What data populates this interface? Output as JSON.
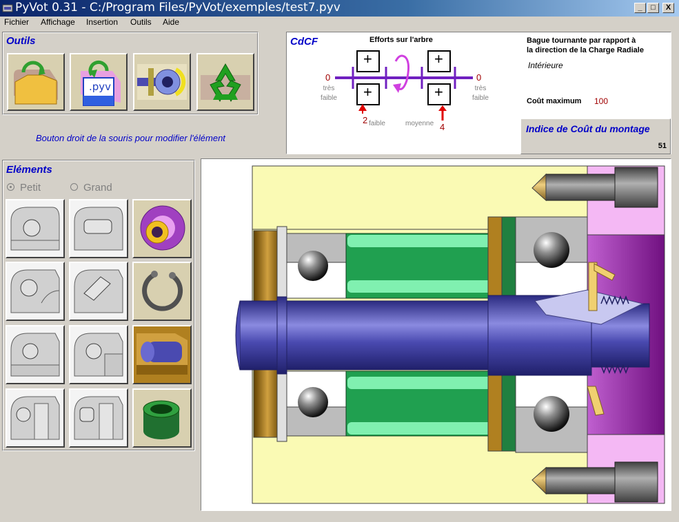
{
  "window": {
    "title": "PyVot 0.31 - C:/Program Files/PyVot/exemples/test7.pyv",
    "min_label": "_",
    "max_label": "□",
    "close_label": "X"
  },
  "menu": [
    "Fichier",
    "Affichage",
    "Insertion",
    "Outils",
    "Aide"
  ],
  "outils": {
    "title": "Outils",
    "buttons": [
      {
        "name": "open-file",
        "icon": "folder-open-icon"
      },
      {
        "name": "save-pyv",
        "icon": "save-pyv-icon",
        "label": ".pyv"
      },
      {
        "name": "assembly-view",
        "icon": "assembly-icon"
      },
      {
        "name": "recycle",
        "icon": "recycle-icon"
      }
    ]
  },
  "hint": "Bouton droit de la souris pour modifier l'élément",
  "elements": {
    "title": "Eléments",
    "size_small": "Petit",
    "size_large": "Grand",
    "selected_size": "Petit",
    "items": [
      {
        "name": "ball-bearing",
        "icon": "ball-bearing-icon"
      },
      {
        "name": "roller-bearing",
        "icon": "roller-bearing-icon"
      },
      {
        "name": "lock-nut-washer",
        "icon": "lock-nut-icon"
      },
      {
        "name": "ball-bearing-small",
        "icon": "ball-bearing-small-icon"
      },
      {
        "name": "tapered-roller-bearing",
        "icon": "tapered-bearing-icon"
      },
      {
        "name": "circlip",
        "icon": "circlip-icon"
      },
      {
        "name": "angular-ball-bearing",
        "icon": "angular-bearing-icon"
      },
      {
        "name": "needle-bearing",
        "icon": "needle-bearing-icon"
      },
      {
        "name": "shaft-shoulder",
        "icon": "shaft-icon"
      },
      {
        "name": "double-ball-bearing",
        "icon": "double-bearing-icon"
      },
      {
        "name": "double-roller-bearing",
        "icon": "double-roller-icon"
      },
      {
        "name": "bushing",
        "icon": "bushing-icon"
      }
    ]
  },
  "cdcf": {
    "title": "CdCF",
    "efforts_title": "Efforts sur l'arbre",
    "left_value": "0",
    "left_label_1": "très",
    "left_label_2": "faible",
    "right_value": "0",
    "right_label_1": "très",
    "right_label_2": "faible",
    "plus": "+",
    "arrow1_value": "2",
    "arrow1_label": "faible",
    "arrow2_value": "4",
    "arrow2_label": "moyenne",
    "bague_line1": "Bague tournante par rapport à",
    "bague_line2": "la direction de la Charge Radiale",
    "bague_value": "Intérieure",
    "cout_max_label": "Coût maximum",
    "cout_max_value": "100"
  },
  "cost": {
    "title": "Indice de Coût du montage",
    "value": "51"
  },
  "colors": {
    "accent_blue": "#0000c8",
    "value_red": "#a00000",
    "shaft": "#4a4aa8",
    "housing_yellow": "#fafab4",
    "bearing_gray": "#bcbcbc",
    "roller_green": "#20a050",
    "magenta": "#f0a0f0"
  }
}
